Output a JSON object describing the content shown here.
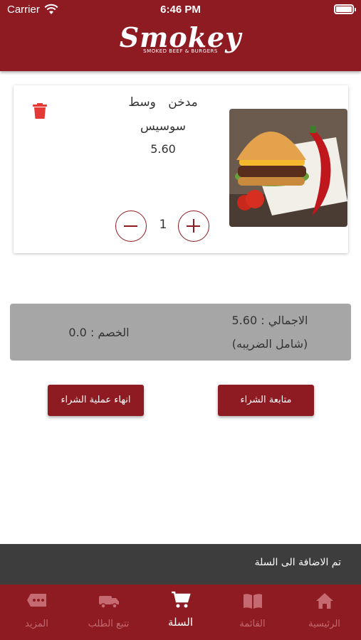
{
  "status_bar": {
    "carrier": "Carrier",
    "time": "6:46 PM"
  },
  "header": {
    "logo_text": "Smokey",
    "logo_tagline": "SMOKED BEEF & BURGERS"
  },
  "cart": {
    "items": [
      {
        "type": "مدخن",
        "size": "وسط",
        "sauce": "سوسيس",
        "price": "5.60",
        "quantity": "1",
        "image_icon": "burger-image"
      }
    ]
  },
  "summary": {
    "total_label": "الاجمالي : 5.60",
    "tax_note": "(شامل الضريبه)",
    "discount_label": "الخصم : 0.0"
  },
  "actions": {
    "continue_label": "متابعة الشراء",
    "end_label": "انهاء عملية الشراء"
  },
  "toast": {
    "message": "تم الاضافة الى السلة"
  },
  "tabbar": {
    "tabs": [
      {
        "label": "الرئيسية",
        "icon": "home-icon"
      },
      {
        "label": "القائمة",
        "icon": "menu-book-icon"
      },
      {
        "label": "السلة",
        "icon": "cart-icon",
        "active": true
      },
      {
        "label": "تتبع الطلب",
        "icon": "truck-icon"
      },
      {
        "label": "المزيد",
        "icon": "more-icon"
      }
    ]
  },
  "colors": {
    "brand": "#8e1a22",
    "summary_bg": "#a6a6a6",
    "toast_bg": "#3d3d3d",
    "delete": "#e53935"
  }
}
